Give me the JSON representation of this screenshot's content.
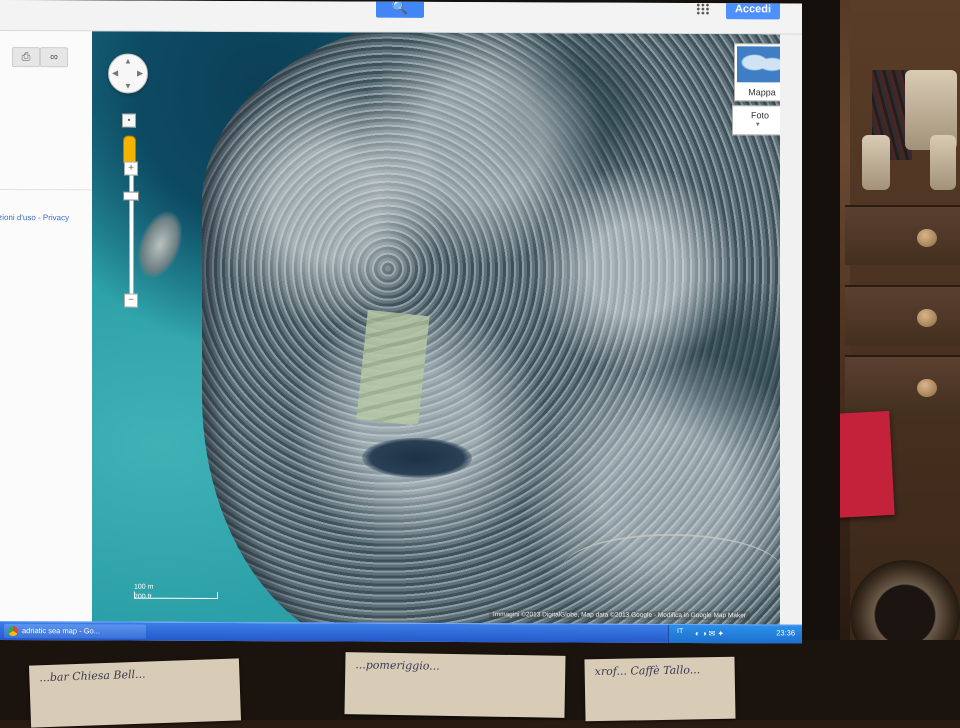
{
  "browser": {
    "search_button_label": "🔍",
    "signin_label": "Accedi",
    "apps_icon": "apps-grid-icon"
  },
  "left_panel": {
    "print_icon": "⎙",
    "link_icon": "∞",
    "terms_text": "dizioni d'uso - Privacy"
  },
  "map": {
    "map_type": {
      "map_label": "Mappa",
      "photo_label": "Foto"
    },
    "pan_arrows": {
      "up": "▲",
      "down": "▼",
      "left": "◀",
      "right": "▶"
    },
    "zoom_plus": "+",
    "zoom_minus": "−",
    "scale": {
      "metric": "100 m",
      "imperial": "200 ft"
    },
    "attribution": "Immagini ©2013 DigitalGlobe, Map data ©2013 Google - Modifica in Google Map Maker"
  },
  "taskbar": {
    "window_title": "adriatic sea map - Go...",
    "tray_language": "IT",
    "clock": "23:36"
  },
  "desk_notes": [
    "...bar Chiesa Bell...",
    "...pomeriggio...",
    "xrof... Caffè Tallo..."
  ],
  "colors": {
    "accent_blue": "#4285f4",
    "signin_blue": "#4d90fe",
    "taskbar_blue": "#2456c8",
    "sticky_red": "#c4223a"
  }
}
